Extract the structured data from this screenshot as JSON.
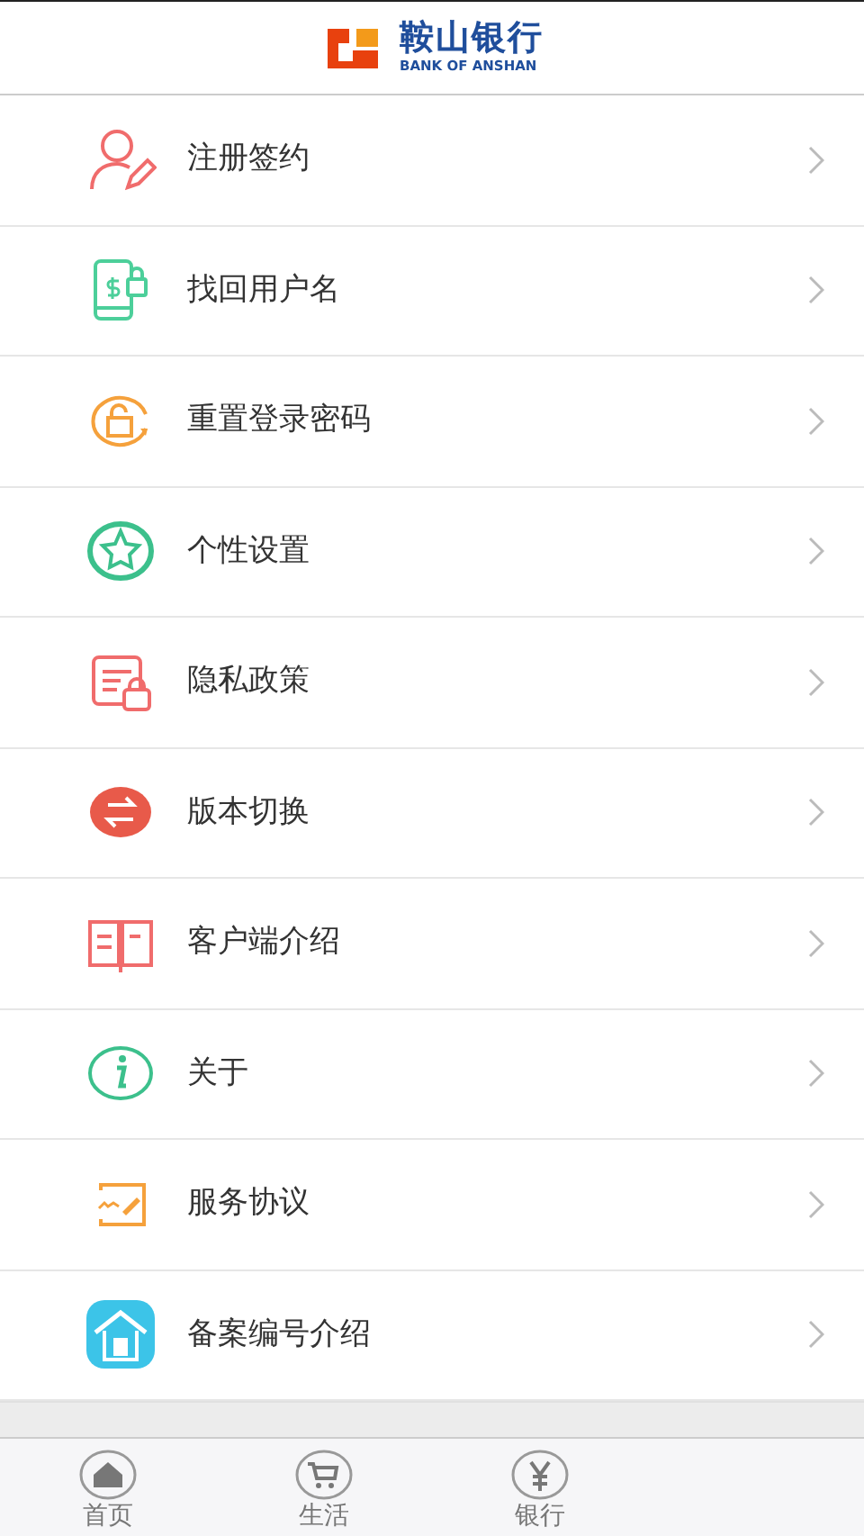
{
  "header": {
    "bank_name": "鞍山银行",
    "bank_name_en": "BANK OF ANSHAN"
  },
  "menu_items": [
    {
      "label": "注册签约"
    },
    {
      "label": "找回用户名"
    },
    {
      "label": "重置登录密码"
    },
    {
      "label": "个性设置"
    },
    {
      "label": "隐私政策"
    },
    {
      "label": "版本切换"
    },
    {
      "label": "客户端介绍"
    },
    {
      "label": "关于"
    },
    {
      "label": "服务协议"
    },
    {
      "label": "备案编号介绍"
    }
  ],
  "tab_bar": [
    {
      "label": "首页"
    },
    {
      "label": "生活"
    },
    {
      "label": "银行"
    }
  ]
}
